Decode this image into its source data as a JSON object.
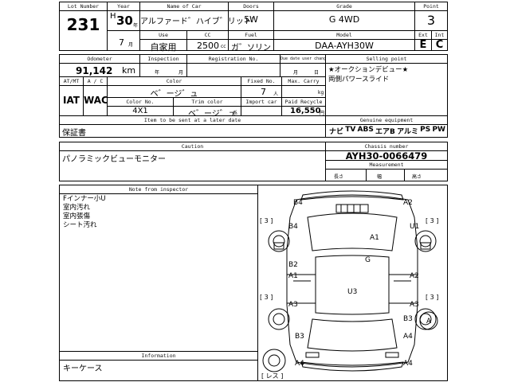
{
  "row1": {
    "lot_number": {
      "label": "Lot Number",
      "value": "231"
    },
    "year": {
      "label": "Year",
      "era": "H",
      "value": "30",
      "suffix": "年",
      "month": "7",
      "month_suffix": "月"
    },
    "name_of_car": {
      "label": "Name of Car",
      "value": "アルファード゛ハイブ゛リット゛"
    },
    "use": {
      "label": "Use",
      "value": "自家用"
    },
    "cc": {
      "label": "CC",
      "value": "2500",
      "unit": "cc"
    },
    "doors": {
      "label": "Doors",
      "value": "5W"
    },
    "fuel": {
      "label": "Fuel",
      "value": "ガ゛ソリン"
    },
    "grade": {
      "label": "Grade",
      "value": "G 4WD"
    },
    "model": {
      "label": "Model",
      "value": "DAA-AYH30W"
    },
    "point": {
      "label": "Point",
      "value": "3"
    },
    "ext": {
      "label": "Ext",
      "value": "E"
    },
    "int": {
      "label": "Int",
      "value": "C"
    }
  },
  "row2": {
    "odometer": {
      "label": "Odometer",
      "value": "91,142",
      "unit": "km"
    },
    "inspection": {
      "label": "Inspection",
      "year_suffix": "年",
      "month_suffix": "月"
    },
    "registration_no": {
      "label": "Registration No."
    },
    "due_date": {
      "label": "Due date user change",
      "month_suffix": "月",
      "day_suffix": "日"
    },
    "selling_point": {
      "label": "Selling point",
      "line1": "★オークションデビュー★",
      "line2": "両側パワースライド"
    }
  },
  "row3": {
    "at_mt": {
      "label": "AT/MT",
      "value": "IAT"
    },
    "ac": {
      "label": "A / C",
      "value": "WAC"
    },
    "color": {
      "label": "Color",
      "value": "ベ゛ージ゛ュ"
    },
    "fixed_no": {
      "label": "Fixed No.",
      "value": "7",
      "unit": "人"
    },
    "max_carry": {
      "label": "Max. Carry",
      "unit": "kg"
    },
    "color_no": {
      "label": "Color No.",
      "value": "4X1"
    },
    "trim_color": {
      "label": "Trim color",
      "value": "ベ゛ージ゛ュ",
      "suffix": "系"
    },
    "import_car": {
      "label": "Import car"
    },
    "paid_recycle": {
      "label": "Paid Recycle",
      "value": "16,550",
      "unit": "円"
    }
  },
  "row4": {
    "items_label": "Item to be sent at a later date",
    "items_value": "保証書",
    "genuine_label": "Genuine equipment",
    "genuine_items": [
      "ナビ",
      "TV",
      "ABS",
      "エアB",
      "アルミ",
      "PS",
      "PW"
    ]
  },
  "row5": {
    "caution_label": "Caution",
    "caution_value": "パノラミックビューモニター",
    "chassis_label": "Chassis number",
    "chassis_value": "AYH30-0066479",
    "measurement_label": "Measurement",
    "length": "長さ",
    "width": "幅",
    "height": "高さ"
  },
  "notes": {
    "label": "Note from inspector",
    "lines": [
      "Fインナー小U",
      "室内汚れ",
      "室内張傷",
      "シート汚れ"
    ]
  },
  "information": {
    "label": "Information",
    "value": "キーケース"
  },
  "diagram": {
    "marks": [
      "B4",
      "A2",
      "B4",
      "U1",
      "A1",
      "G",
      "B2",
      "A1",
      "A2",
      "U3",
      "A3",
      "A3",
      "B3",
      "A",
      "B3",
      "A4",
      "A4",
      "A4"
    ],
    "counts": [
      "[ 3 ]",
      "[ 3 ]",
      "[ 3 ]",
      "[ 3 ]"
    ],
    "spare_label": "[ レス ]"
  }
}
